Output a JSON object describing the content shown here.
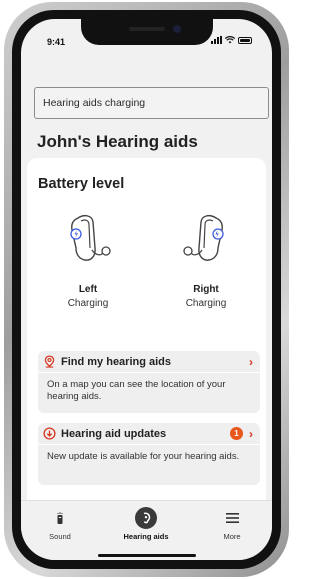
{
  "status": {
    "time": "9:41"
  },
  "toast": {
    "text": "Hearing aids charging"
  },
  "page": {
    "title": "John's Hearing aids"
  },
  "battery": {
    "title": "Battery level",
    "left": {
      "side": "Left",
      "state": "Charging"
    },
    "right": {
      "side": "Right",
      "state": "Charging"
    }
  },
  "actions": {
    "find": {
      "label": "Find my hearing aids",
      "body": "On a map you can see the location of your hearing aids."
    },
    "update": {
      "label": "Hearing aid updates",
      "badge": "1",
      "body": "New update is available for your hearing aids."
    }
  },
  "tabs": [
    {
      "label": "Sound",
      "icon": "sound-icon"
    },
    {
      "label": "Hearing aids",
      "icon": "hearing-aids-icon"
    },
    {
      "label": "More",
      "icon": "menu-icon"
    }
  ],
  "colors": {
    "accent": "#d6361f",
    "badge": "#e8571c",
    "charging": "#3b5bdb"
  }
}
